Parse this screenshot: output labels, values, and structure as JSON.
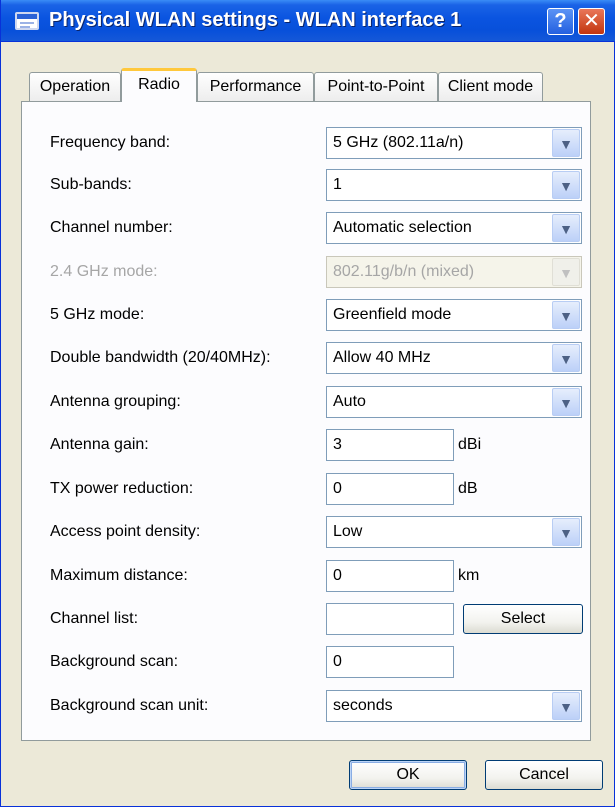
{
  "window": {
    "title": "Physical WLAN settings - WLAN interface 1",
    "help_label": "?",
    "close_label": "✕"
  },
  "tabs": [
    {
      "label": "Operation",
      "active": false
    },
    {
      "label": "Radio",
      "active": true
    },
    {
      "label": "Performance",
      "active": false
    },
    {
      "label": "Point-to-Point",
      "active": false
    },
    {
      "label": "Client mode",
      "active": false
    }
  ],
  "fields": {
    "frequency_band": {
      "label": "Frequency band:",
      "value": "5 GHz (802.11a/n)"
    },
    "sub_bands": {
      "label": "Sub-bands:",
      "value": "1"
    },
    "channel_number": {
      "label": "Channel number:",
      "value": "Automatic selection"
    },
    "mode_24ghz": {
      "label": "2.4 GHz mode:",
      "value": "802.11g/b/n (mixed)",
      "disabled": true
    },
    "mode_5ghz": {
      "label": "5 GHz mode:",
      "value": "Greenfield mode"
    },
    "double_bandwidth": {
      "label": "Double bandwidth (20/40MHz):",
      "value": "Allow 40 MHz"
    },
    "antenna_grouping": {
      "label": "Antenna grouping:",
      "value": "Auto"
    },
    "antenna_gain": {
      "label": "Antenna gain:",
      "value": "3",
      "unit": "dBi"
    },
    "tx_power_reduction": {
      "label": "TX power reduction:",
      "value": "0",
      "unit": "dB"
    },
    "ap_density": {
      "label": "Access point density:",
      "value": "Low"
    },
    "max_distance": {
      "label": "Maximum distance:",
      "value": "0",
      "unit": "km"
    },
    "channel_list": {
      "label": "Channel list:",
      "value": "",
      "button": "Select"
    },
    "background_scan": {
      "label": "Background scan:",
      "value": "0"
    },
    "background_scan_unit": {
      "label": "Background scan unit:",
      "value": "seconds"
    }
  },
  "buttons": {
    "ok": "OK",
    "cancel": "Cancel"
  },
  "colors": {
    "title_bar": "#0A54E0",
    "dialog_bg": "#ECE9D8",
    "panel_bg": "#FCFCFE",
    "tab_highlight": "#FFC83C",
    "close_button": "#D9441C"
  }
}
